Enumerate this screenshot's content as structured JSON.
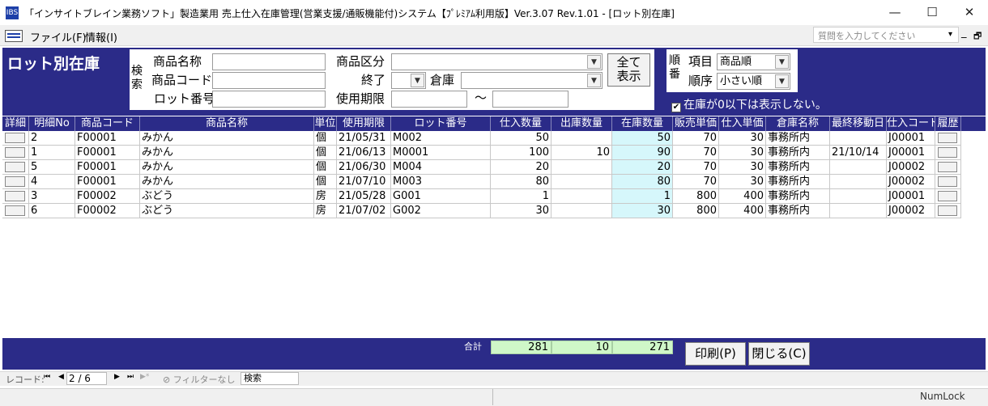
{
  "window": {
    "title": "「インサイトブレイン業務ソフト」製造業用 売上仕入在庫管理(営業支援/通販機能付)システム【ﾌﾟﾚﾐｱﾑ利用版】Ver.3.07 Rev.1.01 - [ロット別在庫]",
    "icon_text": "IBS",
    "minimize_symbol": "—",
    "maximize_symbol": "☐",
    "close_symbol": "✕"
  },
  "menu": {
    "items": [
      "ファイル(F)",
      "情報(I)"
    ],
    "help_placeholder": "質問を入力してください",
    "help_arrow": "▾",
    "mdi_minimize": "_",
    "mdi_restore": "🗗"
  },
  "form": {
    "title": "ロット別在庫",
    "search": {
      "caption": "検索",
      "product_name_label": "商品名称",
      "product_code_label": "商品コード",
      "lot_no_label": "ロット番号",
      "product_category_label": "商品区分",
      "end_label": "終了",
      "warehouse_label": "倉庫",
      "expiry_label": "使用期限",
      "range_sep": "～",
      "show_all_label": "全て\n表示",
      "product_name_value": "",
      "product_code_value": "",
      "lot_no_value": "",
      "category_value": "",
      "end_value": "",
      "warehouse_value": "",
      "expiry_from": "",
      "expiry_to": ""
    },
    "sort": {
      "caption": "順番",
      "item_label": "項目",
      "item_value": "商品順",
      "order_label": "順序",
      "order_value": "小さい順"
    },
    "hide_zero": {
      "checked": true,
      "mark": "✔",
      "label": "在庫が0以下は表示しない。"
    }
  },
  "grid": {
    "columns": [
      "詳細",
      "明細No",
      "商品コード",
      "商品名称",
      "単位",
      "使用期限",
      "ロット番号",
      "仕入数量",
      "出庫数量",
      "在庫数量",
      "販売単価",
      "仕入単価",
      "倉庫名称",
      "最終移動日",
      "仕入コード",
      "履歴"
    ],
    "rows": [
      {
        "no": "2",
        "code": "F00001",
        "name": "みかん",
        "unit": "個",
        "expiry": "21/05/31",
        "lot": "M002",
        "in": "50",
        "out": "",
        "stock": "50",
        "sale": "70",
        "cost": "30",
        "warehouse": "事務所内",
        "last_move": "",
        "supplier": "J00001"
      },
      {
        "no": "1",
        "code": "F00001",
        "name": "みかん",
        "unit": "個",
        "expiry": "21/06/13",
        "lot": "M0001",
        "in": "100",
        "out": "10",
        "stock": "90",
        "sale": "70",
        "cost": "30",
        "warehouse": "事務所内",
        "last_move": "21/10/14",
        "supplier": "J00001"
      },
      {
        "no": "5",
        "code": "F00001",
        "name": "みかん",
        "unit": "個",
        "expiry": "21/06/30",
        "lot": "M004",
        "in": "20",
        "out": "",
        "stock": "20",
        "sale": "70",
        "cost": "30",
        "warehouse": "事務所内",
        "last_move": "",
        "supplier": "J00002"
      },
      {
        "no": "4",
        "code": "F00001",
        "name": "みかん",
        "unit": "個",
        "expiry": "21/07/10",
        "lot": "M003",
        "in": "80",
        "out": "",
        "stock": "80",
        "sale": "70",
        "cost": "30",
        "warehouse": "事務所内",
        "last_move": "",
        "supplier": "J00002"
      },
      {
        "no": "3",
        "code": "F00002",
        "name": "ぶどう",
        "unit": "房",
        "expiry": "21/05/28",
        "lot": "G001",
        "in": "1",
        "out": "",
        "stock": "1",
        "sale": "800",
        "cost": "400",
        "warehouse": "事務所内",
        "last_move": "",
        "supplier": "J00001"
      },
      {
        "no": "6",
        "code": "F00002",
        "name": "ぶどう",
        "unit": "房",
        "expiry": "21/07/02",
        "lot": "G002",
        "in": "30",
        "out": "",
        "stock": "30",
        "sale": "800",
        "cost": "400",
        "warehouse": "事務所内",
        "last_move": "",
        "supplier": "J00002"
      }
    ]
  },
  "footer": {
    "total_label": "合計",
    "total_in": "281",
    "total_out": "10",
    "total_stock": "271",
    "print_label": "印刷(P)",
    "close_label": "閉じる(C)"
  },
  "nav": {
    "record_label": "レコード:",
    "first": "⏮",
    "prev": "◀",
    "position": "2 / 6",
    "next": "▶",
    "last": "⏭",
    "new": "▶*",
    "filter_label": "フィルターなし",
    "search_label": "検索"
  },
  "status": {
    "numlock": "NumLock"
  },
  "colors": {
    "panel": "#2b2b88",
    "stock_cell": "#d6f7fb",
    "total_cell": "#cff7c8"
  }
}
